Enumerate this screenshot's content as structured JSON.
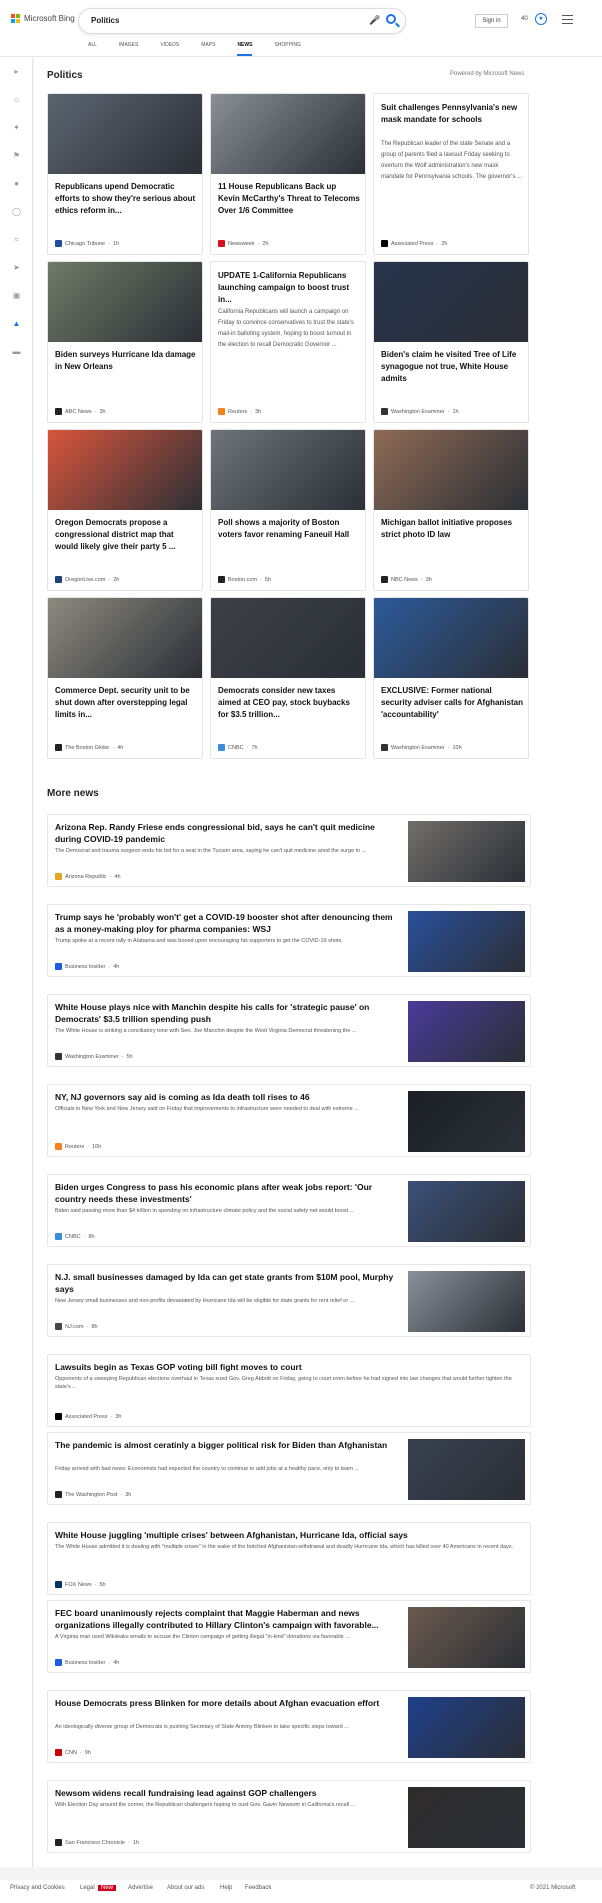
{
  "header": {
    "brand": "Microsoft Bing",
    "search": {
      "value": "Politics"
    },
    "sign_in": "Sign in",
    "rewards": "40",
    "tabs": [
      {
        "label": "ALL"
      },
      {
        "label": "IMAGES"
      },
      {
        "label": "VIDEOS"
      },
      {
        "label": "MAPS"
      },
      {
        "label": "NEWS",
        "selected": true
      },
      {
        "label": "SHOPPING"
      }
    ],
    "brand_colors": [
      "#f25022",
      "#7fba00",
      "#00a4ef",
      "#ffb900"
    ],
    "accent": "#1a73e8"
  },
  "sidebar": {
    "icons": [
      "expand-arrow-icon",
      "home-icon",
      "sparkle-icon",
      "flag-icon",
      "location-icon",
      "globe-icon",
      "science-icon",
      "rocket-icon",
      "entertainment-icon",
      "politics-icon",
      "money-icon"
    ]
  },
  "section": {
    "title": "Politics",
    "powered": "Powered by Microsoft News"
  },
  "cards": [
    {
      "title": "Republicans upend Democratic efforts to show they're serious about ethics reform in...",
      "source": "Chicago Tribune",
      "time": "1h",
      "img": "#5b6470",
      "icon_color": "#1f4e9c"
    },
    {
      "title": "11 House Republicans Back up Kevin McCarthy's Threat to Telecoms Over 1/6 Committee",
      "source": "Newsweek",
      "time": "2h",
      "img": "#8a8f96",
      "icon_color": "#d3121d"
    },
    {
      "title": "Suit challenges Pennsylvania's new mask mandate for schools",
      "snippet": "The Republican leader of the state Senate and a group of parents filed a lawsuit Friday seeking to overturn the Wolf administration's new mask mandate for Pennsylvania schools. The governor's ...",
      "source": "Associated Press",
      "time": "2h",
      "icon_color": "#000000"
    },
    {
      "title": "Biden surveys Hurricane Ida damage in New Orleans",
      "source": "ABC News",
      "time": "3h",
      "img": "#6f7a66",
      "icon_color": "#222222"
    },
    {
      "title": "UPDATE 1-California Republicans launching campaign to boost trust in...",
      "snippet": "California Republicans will launch a campaign on Friday to convince conservatives to trust the state's mail-in balloting system, hoping to boost turnout in the election to recall Democratic Governor ...",
      "source": "Reuters",
      "time": "3h",
      "icon_color": "#f58220"
    },
    {
      "title": "Biden's claim he visited Tree of Life synagogue not true, White House admits",
      "source": "Washington Examiner",
      "time": "1h",
      "img": "#27344c",
      "icon_color": "#333333"
    },
    {
      "title": "Oregon Democrats propose a congressional district map that would likely give their party 5 ...",
      "source": "OregonLive.com",
      "time": "2h",
      "img": "#d9553c",
      "icon_color": "#1d3f7a"
    },
    {
      "title": "Poll shows a majority of Boston voters favor renaming Faneuil Hall",
      "source": "Boston.com",
      "time": "5h",
      "img": "#6e747a",
      "icon_color": "#222222"
    },
    {
      "title": "Michigan ballot initiative proposes strict photo ID law",
      "source": "NBC News",
      "time": "3h",
      "img": "#8e6b55",
      "icon_color": "#222222"
    },
    {
      "title": "Commerce Dept. security unit to be shut down after overstepping legal limits in...",
      "source": "The Boston Globe",
      "time": "4h",
      "img": "#8d8a80",
      "icon_color": "#222222"
    },
    {
      "title": "Democrats consider new taxes aimed at CEO pay, stock buybacks for $3.5 trillion...",
      "source": "CNBC",
      "time": "7h",
      "img": "#3d3f47",
      "icon_color": "#3a8ddd"
    },
    {
      "title": "EXCLUSIVE: Former national security adviser calls for Afghanistan 'accountability'",
      "source": "Washington Examiner",
      "time": "10h",
      "img": "#2d5a9a",
      "icon_color": "#333333"
    }
  ],
  "more": {
    "title": "More news",
    "items": [
      {
        "title": "Arizona Rep. Randy Friese ends congressional bid, says he can't quit medicine during COVID-19 pandemic",
        "snippet": "The Democrat and trauma surgeon ends his bid for a seat in the Tucson area, saying he can't quit medicine amid the surge in ...",
        "source": "Arizona Republic",
        "time": "4h",
        "img": "#726e6a",
        "icon_color": "#e4a521"
      },
      {
        "title": "Trump says he 'probably won't' get a COVID-19 booster shot after denouncing them as a money-making ploy for pharma companies: WSJ",
        "snippet": "Trump spoke at a recent rally in Alabama and was booed upon encouraging his supporters to get the COVID-19 shots.",
        "source": "Business Insider",
        "time": "4h",
        "img": "#2a4f9c",
        "icon_color": "#1a5be6"
      },
      {
        "title": "White House plays nice with Manchin despite his calls for 'strategic pause' on Democrats' $3.5 trillion spending push",
        "snippet": "The White House is striking a conciliatory tone with Sen. Joe Manchin despite the West Virginia Democrat threatening the ...",
        "source": "Washington Examiner",
        "time": "5h",
        "img": "#4a3a9a",
        "icon_color": "#333333"
      },
      {
        "title": "NY, NJ governors say aid is coming as Ida death toll rises to 46",
        "snippet": "Officials in New York and New Jersey said on Friday that improvements to infrastructure were needed to deal with extreme ...",
        "source": "Reuters",
        "time": "10h",
        "img": "#1c2026",
        "icon_color": "#f58220"
      },
      {
        "title": "Biden urges Congress to pass his economic plans after weak jobs report: 'Our country needs these investments'",
        "snippet": "Biden said passing more than $4 trillion in spending on infrastructure climate policy and the social safety net would boost ...",
        "source": "CNBC",
        "time": "8h",
        "img": "#3b4f78",
        "icon_color": "#3a8ddd"
      },
      {
        "title": "N.J. small businesses damaged by Ida can get state grants from $10M pool, Murphy says",
        "snippet": "New Jersey small businesses and non-profits devastated by Hurricane Ida will be eligible for state grants for rent relief or ...",
        "source": "NJ.com",
        "time": "8h",
        "img": "#8a9099",
        "icon_color": "#444444"
      },
      {
        "title": "Lawsuits begin as Texas GOP voting bill fight moves to court",
        "snippet": "Opponents of a sweeping Republican elections overhaul in Texas sued Gov. Greg Abbott on Friday, going to court even before he had signed into law changes that would further tighten the state's ...",
        "source": "Associated Press",
        "time": "3h",
        "icon_color": "#000000"
      },
      {
        "title": "The pandemic is almost ceratinly a bigger political risk for Biden than Afghanistan",
        "snippet": "Friday arrived with bad news: Economists had expected the country to continue to add jobs at a healthy pace, only to learn ...",
        "source": "The Washington Post",
        "time": "3h",
        "img": "#38414f",
        "icon_color": "#222222"
      },
      {
        "title": "White House juggling 'multiple crises' between Afghanistan, Hurricane Ida, official says",
        "snippet": "The White House admitted it is dealing with \"multiple crises\" in the wake of the botched Afghanistan withdrawal and deadly Hurricane Ida, which has killed over 40 Americans in recent days.",
        "source": "FOX News",
        "time": "5h",
        "icon_color": "#003366"
      },
      {
        "title": "FEC board unanimously rejects complaint that Maggie Haberman and news organizations illegally contributed to Hillary Clinton's campaign with favorable...",
        "snippet": "A Virginia man used Wikileaks emails to accuse the Clinton campaign of getting illegal \"in-kind\" donations via favorable ...",
        "source": "Business Insider",
        "time": "4h",
        "img": "#6b5a4e",
        "icon_color": "#1a5be6"
      },
      {
        "title": "House Democrats press Blinken for more details about Afghan evacuation effort",
        "snippet": "An ideologically diverse group of Democrats is pushing Secretary of State Antony Blinken to take specific steps toward ...",
        "source": "CNN",
        "time": "9h",
        "img": "#1e3f8a",
        "icon_color": "#cc0000"
      },
      {
        "title": "Newsom widens recall fundraising lead against GOP challengers",
        "snippet": "With Election Day around the corner, the Republican challengers hoping to oust Gov. Gavin Newsom in California's recall ...",
        "source": "San Francisco Chronicle",
        "time": "1h",
        "img": "#2e2b2a",
        "icon_color": "#222222"
      }
    ]
  },
  "footer": {
    "links": [
      "Privacy and Cookies",
      "Legal",
      "Advertise",
      "About our ads",
      "Help",
      "Feedback"
    ],
    "new_badge": "New",
    "copyright": "© 2021 Microsoft"
  }
}
